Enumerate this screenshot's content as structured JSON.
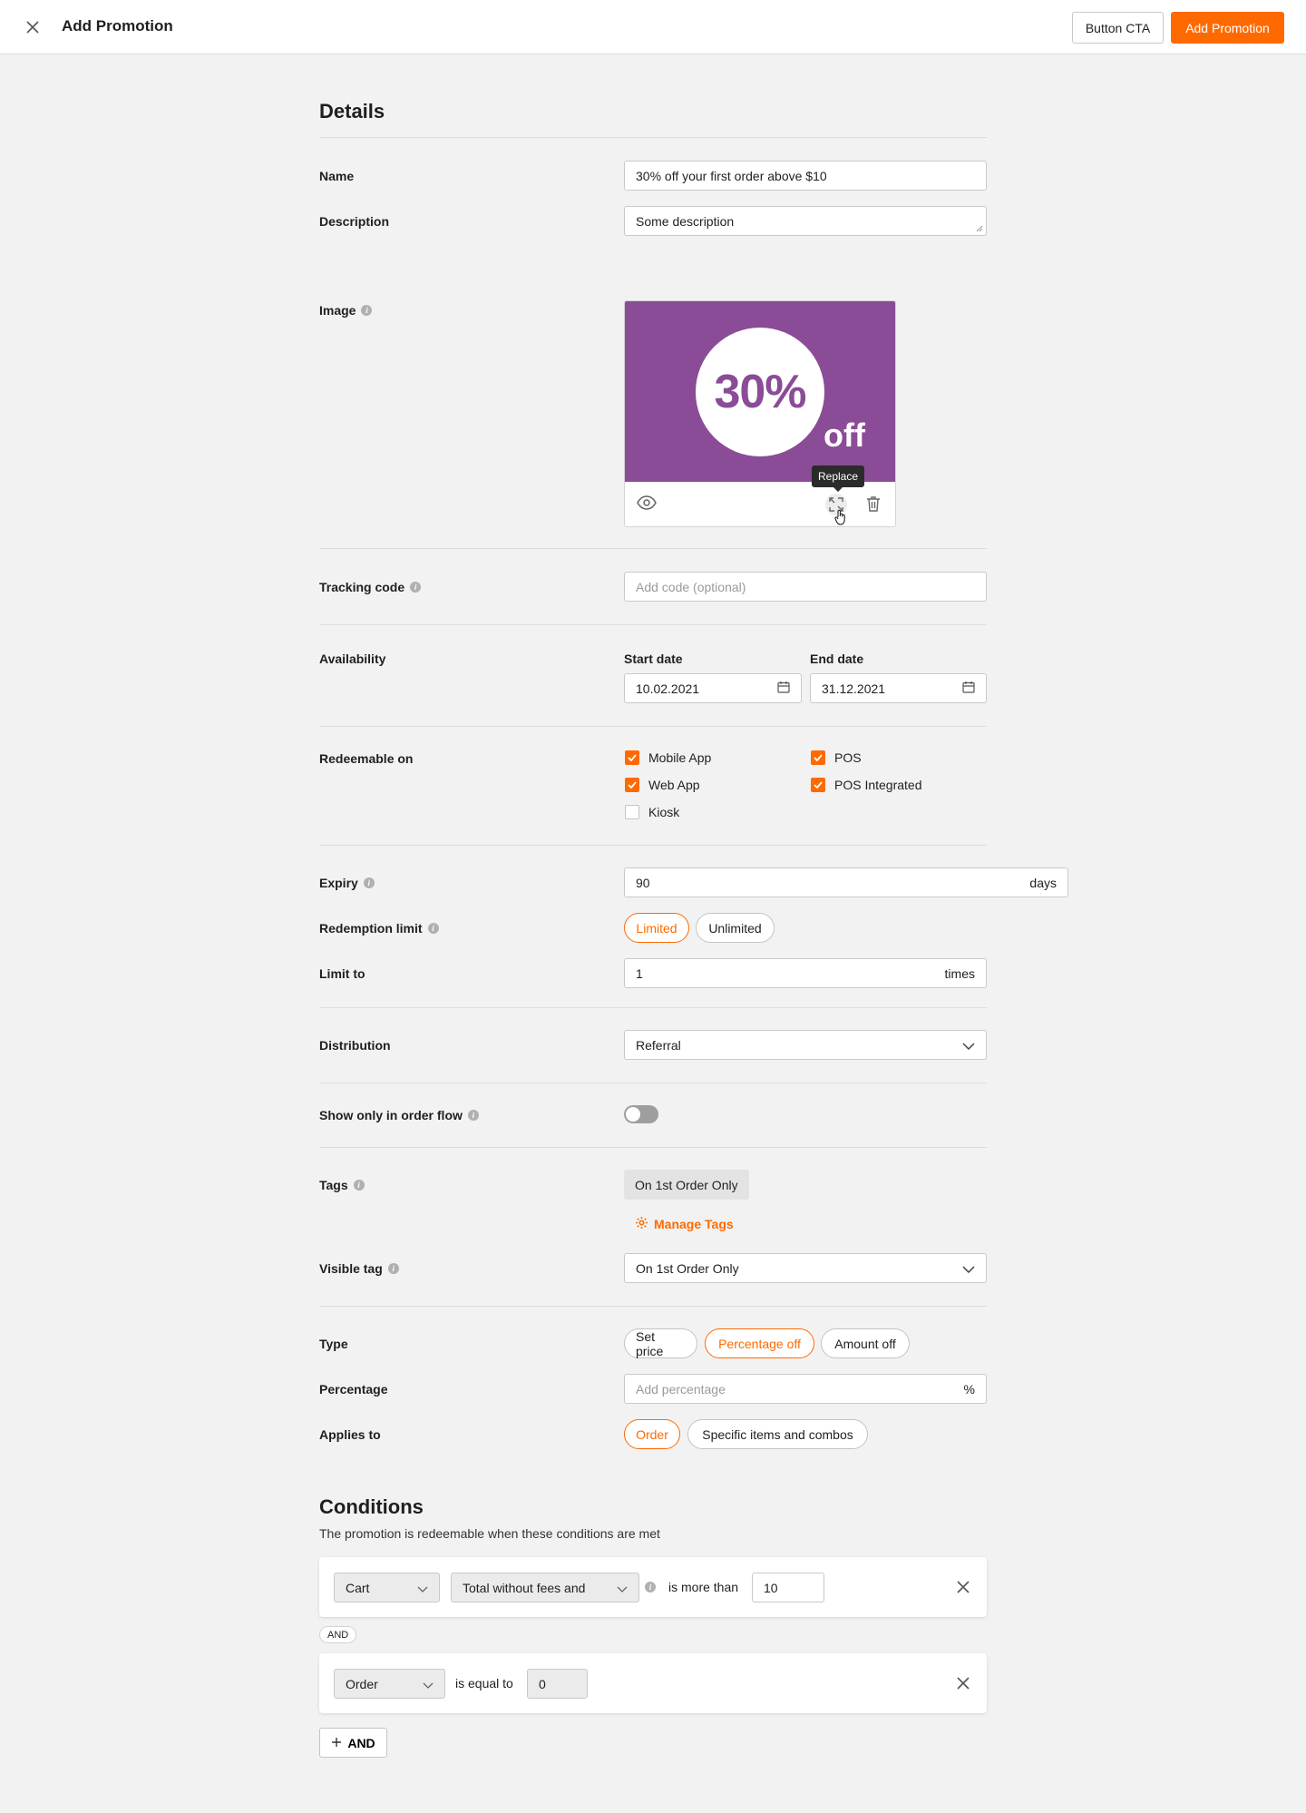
{
  "header": {
    "title": "Add Promotion",
    "secondary_button": "Button CTA",
    "primary_button": "Add Promotion",
    "accent_color": "#ff6a00"
  },
  "details": {
    "heading": "Details",
    "name_label": "Name",
    "name_value": "30% off your first order above $10",
    "description_label": "Description",
    "description_value": "Some description",
    "image_label": "Image",
    "image_percent_text": "30%",
    "image_off_text": "off",
    "image_bg_color": "#8b4c97",
    "image_tooltip": "Replace",
    "tracking_label": "Tracking code",
    "tracking_placeholder": "Add code (optional)",
    "availability_label": "Availability",
    "start_date_label": "Start date",
    "start_date_value": "10.02.2021",
    "end_date_label": "End date",
    "end_date_value": "31.12.2021",
    "redeemable_label": "Redeemable on",
    "redeemable_options": [
      {
        "label": "Mobile App",
        "checked": true
      },
      {
        "label": "POS",
        "checked": true
      },
      {
        "label": "Web App",
        "checked": true
      },
      {
        "label": "POS Integrated",
        "checked": true
      },
      {
        "label": "Kiosk",
        "checked": false
      }
    ],
    "expiry_label": "Expiry",
    "expiry_value": "90",
    "expiry_suffix": "days",
    "redemption_limit_label": "Redemption limit",
    "redemption_options": [
      "Limited",
      "Unlimited"
    ],
    "redemption_selected": "Limited",
    "limit_to_label": "Limit to",
    "limit_to_value": "1",
    "limit_to_suffix": "times",
    "distribution_label": "Distribution",
    "distribution_value": "Referral",
    "order_flow_label": "Show only in order flow",
    "order_flow_on": false,
    "tags_label": "Tags",
    "tag_value": "On 1st Order Only",
    "manage_tags": "Manage Tags",
    "visible_tag_label": "Visible tag",
    "visible_tag_value": "On 1st Order Only",
    "type_label": "Type",
    "type_options": [
      "Set price",
      "Percentage off",
      "Amount off"
    ],
    "type_selected": "Percentage off",
    "percentage_label": "Percentage",
    "percentage_placeholder": "Add percentage",
    "percentage_suffix": "%",
    "applies_label": "Applies to",
    "applies_options": [
      "Order",
      "Specific items and combos"
    ],
    "applies_selected": "Order"
  },
  "conditions": {
    "heading": "Conditions",
    "subtitle": "The promotion is redeemable when these conditions are met",
    "rows": [
      {
        "subject": "Cart",
        "field": "Total without fees and",
        "operator": "is more than",
        "value": "10"
      },
      {
        "subject": "Order",
        "operator": "is equal to",
        "value": "0"
      }
    ],
    "and_chip": "AND",
    "add_button": "AND"
  }
}
